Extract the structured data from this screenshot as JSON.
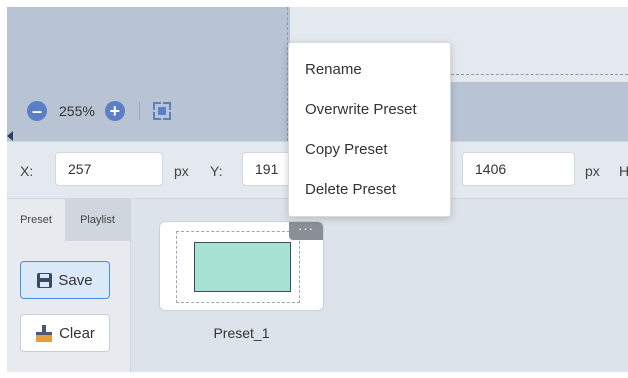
{
  "zoom": {
    "value": "255%",
    "minus_icon": "minus-circle-icon",
    "plus_icon": "plus-circle-icon",
    "fit_icon": "fit-screen-icon"
  },
  "coords": {
    "x_label": "X:",
    "x_value": "257",
    "x_unit": "px",
    "y_label": "Y:",
    "y_value": "191",
    "w_value": "1406",
    "w_unit": "px",
    "h_label_partial": "H"
  },
  "tabs": {
    "preset": "Preset",
    "playlist": "Playlist"
  },
  "buttons": {
    "save": "Save",
    "clear": "Clear",
    "save_icon": "save-icon",
    "clear_icon": "broom-icon"
  },
  "preset_card": {
    "name": "Preset_1",
    "more": "···",
    "thumb_color": "#a8e2d5"
  },
  "context_menu": {
    "items": [
      "Rename",
      "Overwrite Preset",
      "Copy Preset",
      "Delete Preset"
    ]
  },
  "colors": {
    "accent": "#5b7fc7",
    "canvas": "#b8c4d3",
    "button_border": "#4a90e2"
  }
}
